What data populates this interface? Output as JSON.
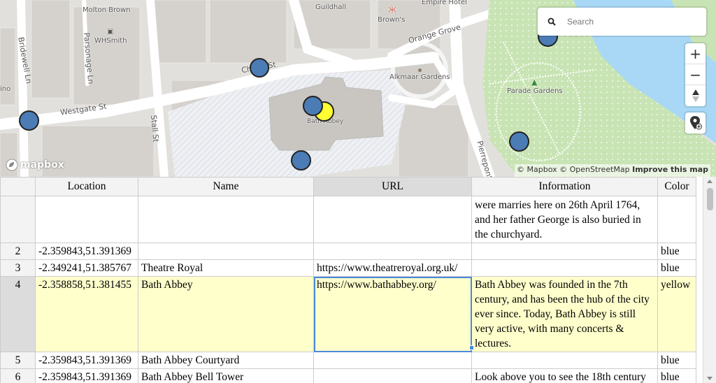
{
  "map": {
    "streets": {
      "bridewell": "Bridewell Ln",
      "parsonage": "Parsonage Ln",
      "westgate": "Westgate St",
      "stall": "Stall St",
      "cheap": "Cheap St",
      "orange_grove": "Orange Grove",
      "pierrepont": "Pierrepont",
      "ino": "ino"
    },
    "pois": {
      "molton_brown": "Molton Brown",
      "whsmith": "WHSmith",
      "guildhall": "Guildhall",
      "browns": "Brown's",
      "empire_hotel": "Empire Hotel",
      "alkmaar_gardens": "Alkmaar Gardens",
      "parade_gardens": "Parade Gardens",
      "bath_abbey": "Bath Abbey"
    },
    "search": {
      "placeholder": "Search"
    },
    "controls": {
      "zoom_in": "+",
      "zoom_out": "−"
    },
    "logo_text": "mapbox",
    "attribution": {
      "mapbox": "© Mapbox",
      "osm": "© OpenStreetMap",
      "improve": "Improve this map"
    },
    "marker_colors": {
      "default": "#4b7cb5",
      "selected": "#ffff33"
    }
  },
  "sheet": {
    "columns": [
      "Location",
      "Name",
      "URL",
      "Information",
      "Color"
    ],
    "rows": [
      {
        "num": "",
        "location": "",
        "name": "",
        "url": "",
        "info": "were marries here on 26th April 1764, and her father George is also buried in the churchyard.",
        "color": ""
      },
      {
        "num": "2",
        "location": "-2.359843,51.391369",
        "name": "",
        "url": "",
        "info": "",
        "color": "blue"
      },
      {
        "num": "3",
        "location": "-2.349241,51.385767",
        "name": "Theatre Royal",
        "url": "https://www.theatreroyal.org.uk/",
        "info": "",
        "color": "blue"
      },
      {
        "num": "4",
        "location": "-2.358858,51.381455",
        "name": "Bath Abbey",
        "url": "https://www.bathabbey.org/",
        "info": "Bath Abbey was founded in the 7th century, and has been the hub of the city ever since. Today, Bath Abbey is still very active, with many concerts & lectures.",
        "color": "yellow"
      },
      {
        "num": "5",
        "location": "-2.359843,51.391369",
        "name": "Bath Abbey Courtyard",
        "url": "",
        "info": "",
        "color": "blue"
      },
      {
        "num": "6",
        "location": "-2.359843,51.391369",
        "name": "Bath Abbey Bell Tower",
        "url": "",
        "info": "Look above you to see the 18th century",
        "color": "blue"
      }
    ],
    "highlight_color": "#ffffcc",
    "selection_color": "#4b89dc"
  }
}
